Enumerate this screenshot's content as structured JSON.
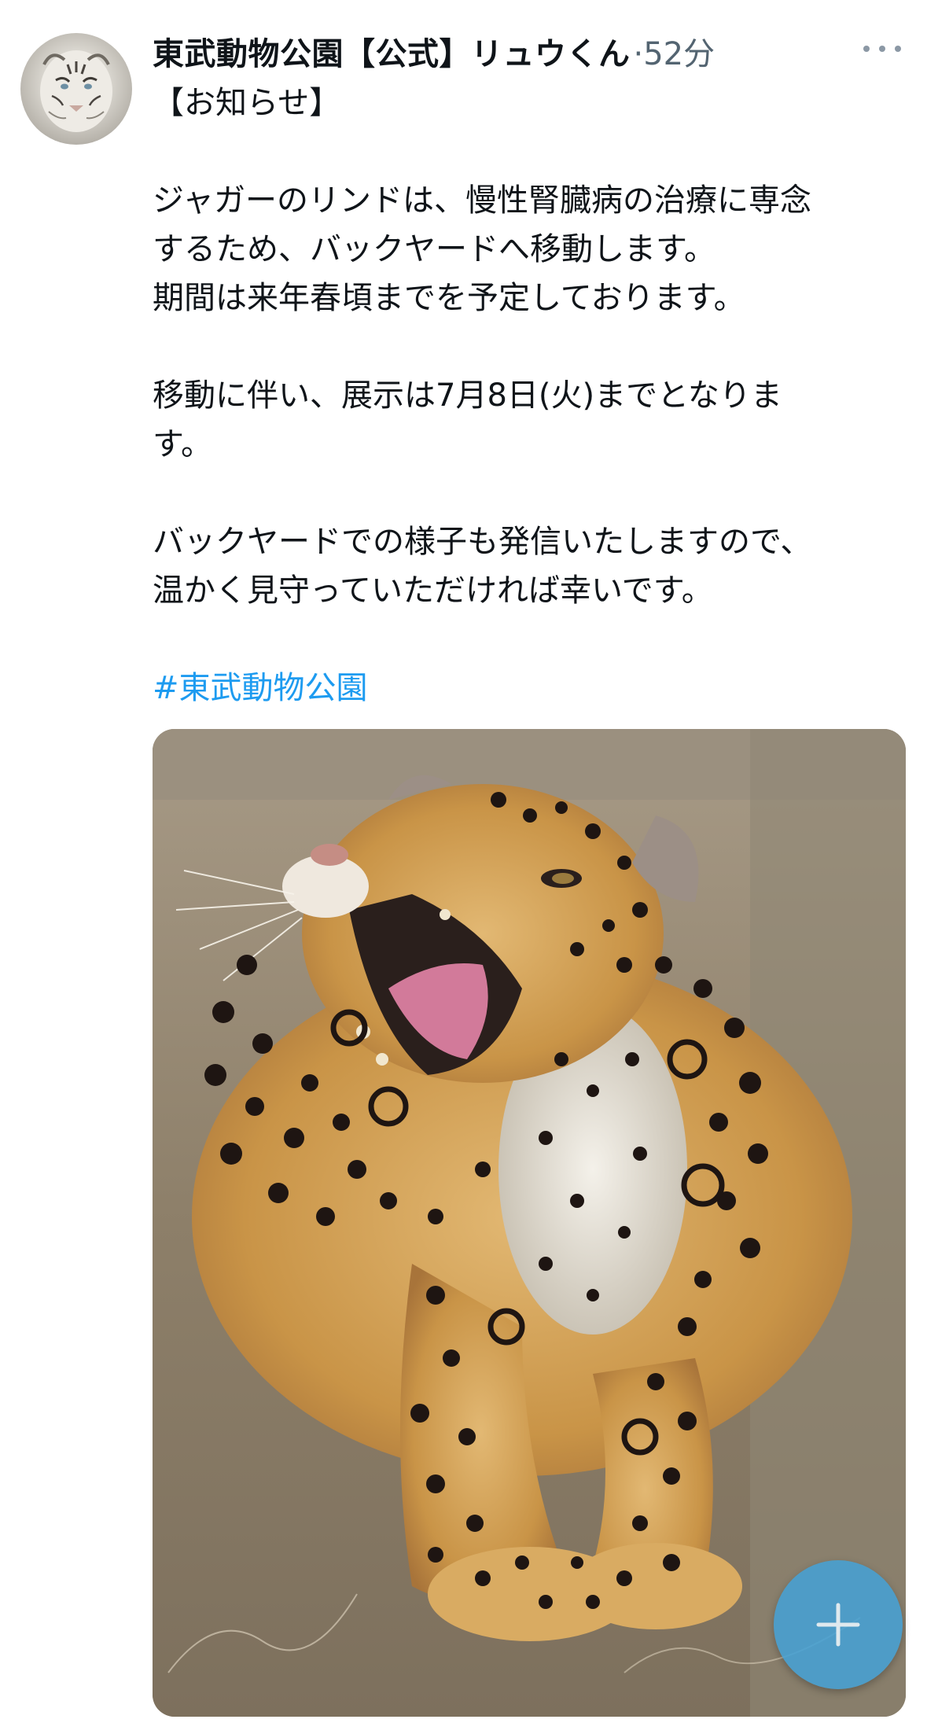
{
  "tweet": {
    "author": {
      "display_name": "東武動物公園【公式】リュウくん",
      "avatar_icon": "white-tiger-avatar"
    },
    "time": "·52分",
    "more_icon": "more-dots-icon",
    "lines": [
      "【お知らせ】",
      "",
      "ジャガーのリンドは、慢性腎臓病の治療に専念",
      "するため、バックヤードへ移動します。",
      "期間は来年春頃までを予定しております。",
      "",
      "移動に伴い、展示は7月8日(火)までとなりま",
      "す。",
      "",
      "バックヤードでの様子も発信いたしますので、",
      "温かく見守っていただければ幸いです。",
      ""
    ],
    "hashtag": "#東武動物公園",
    "media": {
      "subject_icon": "jaguar-photo"
    }
  },
  "compose_button": {
    "icon": "plus-icon"
  },
  "colors": {
    "text": "#0f1419",
    "secondary": "#536471",
    "link": "#1d9bf0",
    "fab": "#45a0d4"
  }
}
